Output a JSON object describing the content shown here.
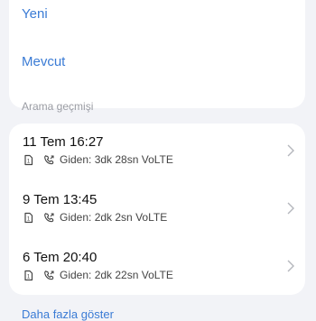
{
  "links": {
    "new": "Yeni",
    "existing": "Mevcut"
  },
  "history": {
    "title": "Arama geçmişi",
    "calls": [
      {
        "date": "11 Tem 16:27",
        "detail": "Giden: 3dk 28sn",
        "tech": "VoLTE"
      },
      {
        "date": "9 Tem 13:45",
        "detail": "Giden: 2dk 2sn",
        "tech": "VoLTE"
      },
      {
        "date": "6 Tem 20:40",
        "detail": "Giden: 2dk 22sn",
        "tech": "VoLTE"
      }
    ],
    "more": "Daha fazla göster"
  },
  "colors": {
    "accent": "#3a7bd5",
    "background": "#f2f3f7",
    "card": "#ffffff"
  },
  "icons": {
    "sim": "sim-card-icon",
    "call": "outgoing-call-icon",
    "chevron": "chevron-right-icon"
  }
}
